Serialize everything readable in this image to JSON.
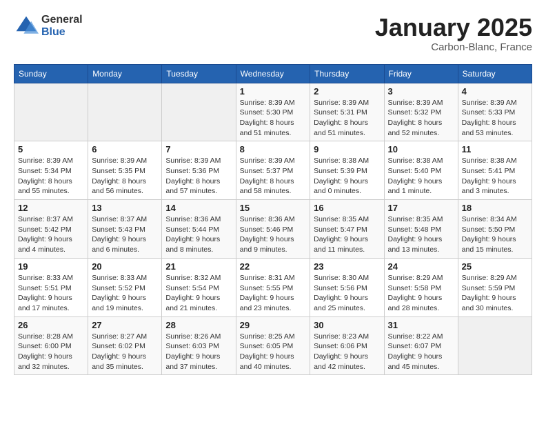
{
  "header": {
    "logo_general": "General",
    "logo_blue": "Blue",
    "month_title": "January 2025",
    "location": "Carbon-Blanc, France"
  },
  "weekdays": [
    "Sunday",
    "Monday",
    "Tuesday",
    "Wednesday",
    "Thursday",
    "Friday",
    "Saturday"
  ],
  "weeks": [
    [
      {
        "day": "",
        "sunrise": "",
        "sunset": "",
        "daylight": "",
        "empty": true
      },
      {
        "day": "",
        "sunrise": "",
        "sunset": "",
        "daylight": "",
        "empty": true
      },
      {
        "day": "",
        "sunrise": "",
        "sunset": "",
        "daylight": "",
        "empty": true
      },
      {
        "day": "1",
        "sunrise": "Sunrise: 8:39 AM",
        "sunset": "Sunset: 5:30 PM",
        "daylight": "Daylight: 8 hours and 51 minutes."
      },
      {
        "day": "2",
        "sunrise": "Sunrise: 8:39 AM",
        "sunset": "Sunset: 5:31 PM",
        "daylight": "Daylight: 8 hours and 51 minutes."
      },
      {
        "day": "3",
        "sunrise": "Sunrise: 8:39 AM",
        "sunset": "Sunset: 5:32 PM",
        "daylight": "Daylight: 8 hours and 52 minutes."
      },
      {
        "day": "4",
        "sunrise": "Sunrise: 8:39 AM",
        "sunset": "Sunset: 5:33 PM",
        "daylight": "Daylight: 8 hours and 53 minutes."
      }
    ],
    [
      {
        "day": "5",
        "sunrise": "Sunrise: 8:39 AM",
        "sunset": "Sunset: 5:34 PM",
        "daylight": "Daylight: 8 hours and 55 minutes."
      },
      {
        "day": "6",
        "sunrise": "Sunrise: 8:39 AM",
        "sunset": "Sunset: 5:35 PM",
        "daylight": "Daylight: 8 hours and 56 minutes."
      },
      {
        "day": "7",
        "sunrise": "Sunrise: 8:39 AM",
        "sunset": "Sunset: 5:36 PM",
        "daylight": "Daylight: 8 hours and 57 minutes."
      },
      {
        "day": "8",
        "sunrise": "Sunrise: 8:39 AM",
        "sunset": "Sunset: 5:37 PM",
        "daylight": "Daylight: 8 hours and 58 minutes."
      },
      {
        "day": "9",
        "sunrise": "Sunrise: 8:38 AM",
        "sunset": "Sunset: 5:39 PM",
        "daylight": "Daylight: 9 hours and 0 minutes."
      },
      {
        "day": "10",
        "sunrise": "Sunrise: 8:38 AM",
        "sunset": "Sunset: 5:40 PM",
        "daylight": "Daylight: 9 hours and 1 minute."
      },
      {
        "day": "11",
        "sunrise": "Sunrise: 8:38 AM",
        "sunset": "Sunset: 5:41 PM",
        "daylight": "Daylight: 9 hours and 3 minutes."
      }
    ],
    [
      {
        "day": "12",
        "sunrise": "Sunrise: 8:37 AM",
        "sunset": "Sunset: 5:42 PM",
        "daylight": "Daylight: 9 hours and 4 minutes."
      },
      {
        "day": "13",
        "sunrise": "Sunrise: 8:37 AM",
        "sunset": "Sunset: 5:43 PM",
        "daylight": "Daylight: 9 hours and 6 minutes."
      },
      {
        "day": "14",
        "sunrise": "Sunrise: 8:36 AM",
        "sunset": "Sunset: 5:44 PM",
        "daylight": "Daylight: 9 hours and 8 minutes."
      },
      {
        "day": "15",
        "sunrise": "Sunrise: 8:36 AM",
        "sunset": "Sunset: 5:46 PM",
        "daylight": "Daylight: 9 hours and 9 minutes."
      },
      {
        "day": "16",
        "sunrise": "Sunrise: 8:35 AM",
        "sunset": "Sunset: 5:47 PM",
        "daylight": "Daylight: 9 hours and 11 minutes."
      },
      {
        "day": "17",
        "sunrise": "Sunrise: 8:35 AM",
        "sunset": "Sunset: 5:48 PM",
        "daylight": "Daylight: 9 hours and 13 minutes."
      },
      {
        "day": "18",
        "sunrise": "Sunrise: 8:34 AM",
        "sunset": "Sunset: 5:50 PM",
        "daylight": "Daylight: 9 hours and 15 minutes."
      }
    ],
    [
      {
        "day": "19",
        "sunrise": "Sunrise: 8:33 AM",
        "sunset": "Sunset: 5:51 PM",
        "daylight": "Daylight: 9 hours and 17 minutes."
      },
      {
        "day": "20",
        "sunrise": "Sunrise: 8:33 AM",
        "sunset": "Sunset: 5:52 PM",
        "daylight": "Daylight: 9 hours and 19 minutes."
      },
      {
        "day": "21",
        "sunrise": "Sunrise: 8:32 AM",
        "sunset": "Sunset: 5:54 PM",
        "daylight": "Daylight: 9 hours and 21 minutes."
      },
      {
        "day": "22",
        "sunrise": "Sunrise: 8:31 AM",
        "sunset": "Sunset: 5:55 PM",
        "daylight": "Daylight: 9 hours and 23 minutes."
      },
      {
        "day": "23",
        "sunrise": "Sunrise: 8:30 AM",
        "sunset": "Sunset: 5:56 PM",
        "daylight": "Daylight: 9 hours and 25 minutes."
      },
      {
        "day": "24",
        "sunrise": "Sunrise: 8:29 AM",
        "sunset": "Sunset: 5:58 PM",
        "daylight": "Daylight: 9 hours and 28 minutes."
      },
      {
        "day": "25",
        "sunrise": "Sunrise: 8:29 AM",
        "sunset": "Sunset: 5:59 PM",
        "daylight": "Daylight: 9 hours and 30 minutes."
      }
    ],
    [
      {
        "day": "26",
        "sunrise": "Sunrise: 8:28 AM",
        "sunset": "Sunset: 6:00 PM",
        "daylight": "Daylight: 9 hours and 32 minutes."
      },
      {
        "day": "27",
        "sunrise": "Sunrise: 8:27 AM",
        "sunset": "Sunset: 6:02 PM",
        "daylight": "Daylight: 9 hours and 35 minutes."
      },
      {
        "day": "28",
        "sunrise": "Sunrise: 8:26 AM",
        "sunset": "Sunset: 6:03 PM",
        "daylight": "Daylight: 9 hours and 37 minutes."
      },
      {
        "day": "29",
        "sunrise": "Sunrise: 8:25 AM",
        "sunset": "Sunset: 6:05 PM",
        "daylight": "Daylight: 9 hours and 40 minutes."
      },
      {
        "day": "30",
        "sunrise": "Sunrise: 8:23 AM",
        "sunset": "Sunset: 6:06 PM",
        "daylight": "Daylight: 9 hours and 42 minutes."
      },
      {
        "day": "31",
        "sunrise": "Sunrise: 8:22 AM",
        "sunset": "Sunset: 6:07 PM",
        "daylight": "Daylight: 9 hours and 45 minutes."
      },
      {
        "day": "",
        "sunrise": "",
        "sunset": "",
        "daylight": "",
        "empty": true
      }
    ]
  ]
}
